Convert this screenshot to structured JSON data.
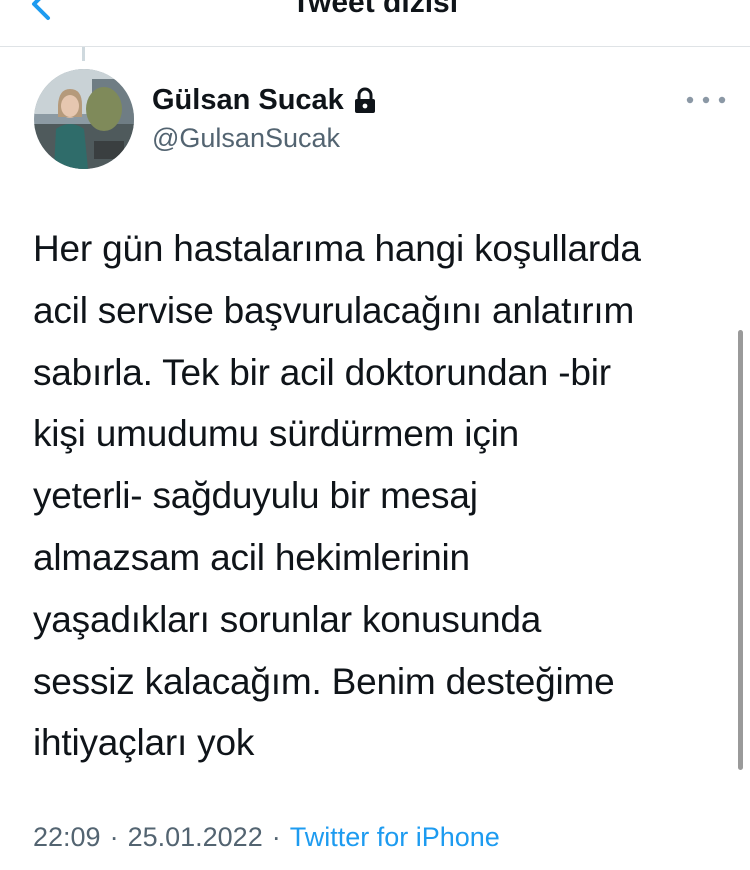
{
  "header": {
    "title": "Tweet dizisi",
    "back_icon": "chevron-left-icon"
  },
  "tweet": {
    "author_name": "Gülsan Sucak",
    "protected_icon": "lock-icon",
    "handle": "@GulsanSucak",
    "text_lines": [
      "Her gün hastalarıma hangi koşullarda",
      "acil servise başvurulacağını anlatırım",
      "sabırla. Tek bir acil doktorundan -bir",
      "kişi umudumu sürdürmem için",
      "yeterli- sağduyulu bir mesaj",
      "almazsam acil hekimlerinin",
      "yaşadıkları sorunlar konusunda",
      "sessiz kalacağım. Benim desteğime",
      "ihtiyaçları yok"
    ],
    "time": "22:09",
    "separator": "·",
    "date": "25.01.2022",
    "source": "Twitter for iPhone"
  },
  "colors": {
    "accent": "#1d9bf0",
    "secondary_text": "#536471",
    "primary_text": "#0f1419",
    "divider": "#dfe3e6"
  }
}
